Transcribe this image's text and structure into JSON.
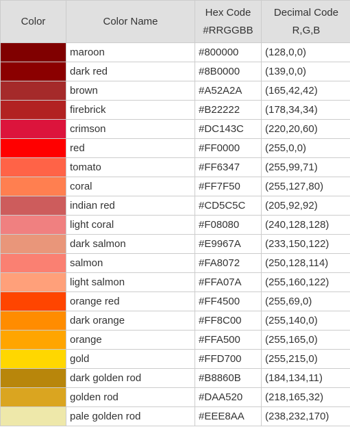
{
  "table": {
    "headers": [
      {
        "line1": "Color",
        "line2": ""
      },
      {
        "line1": "Color Name",
        "line2": ""
      },
      {
        "line1": "Hex Code",
        "line2": "#RRGGBB"
      },
      {
        "line1": "Decimal Code",
        "line2": "R,G,B"
      }
    ],
    "rows": [
      {
        "name": "maroon",
        "hex": "#800000",
        "rgb": "(128,0,0)"
      },
      {
        "name": "dark red",
        "hex": "#8B0000",
        "rgb": "(139,0,0)"
      },
      {
        "name": "brown",
        "hex": "#A52A2A",
        "rgb": "(165,42,42)"
      },
      {
        "name": "firebrick",
        "hex": "#B22222",
        "rgb": "(178,34,34)"
      },
      {
        "name": "crimson",
        "hex": "#DC143C",
        "rgb": "(220,20,60)"
      },
      {
        "name": "red",
        "hex": "#FF0000",
        "rgb": "(255,0,0)"
      },
      {
        "name": "tomato",
        "hex": "#FF6347",
        "rgb": "(255,99,71)"
      },
      {
        "name": "coral",
        "hex": "#FF7F50",
        "rgb": "(255,127,80)"
      },
      {
        "name": "indian red",
        "hex": "#CD5C5C",
        "rgb": "(205,92,92)"
      },
      {
        "name": "light coral",
        "hex": "#F08080",
        "rgb": "(240,128,128)"
      },
      {
        "name": "dark salmon",
        "hex": "#E9967A",
        "rgb": "(233,150,122)"
      },
      {
        "name": "salmon",
        "hex": "#FA8072",
        "rgb": "(250,128,114)"
      },
      {
        "name": "light salmon",
        "hex": "#FFA07A",
        "rgb": "(255,160,122)"
      },
      {
        "name": "orange red",
        "hex": "#FF4500",
        "rgb": "(255,69,0)"
      },
      {
        "name": "dark orange",
        "hex": "#FF8C00",
        "rgb": "(255,140,0)"
      },
      {
        "name": "orange",
        "hex": "#FFA500",
        "rgb": "(255,165,0)"
      },
      {
        "name": "gold",
        "hex": "#FFD700",
        "rgb": "(255,215,0)"
      },
      {
        "name": "dark golden rod",
        "hex": "#B8860B",
        "rgb": "(184,134,11)"
      },
      {
        "name": "golden rod",
        "hex": "#DAA520",
        "rgb": "(218,165,32)"
      },
      {
        "name": "pale golden rod",
        "hex": "#EEE8AA",
        "rgb": "(238,232,170)"
      }
    ]
  }
}
